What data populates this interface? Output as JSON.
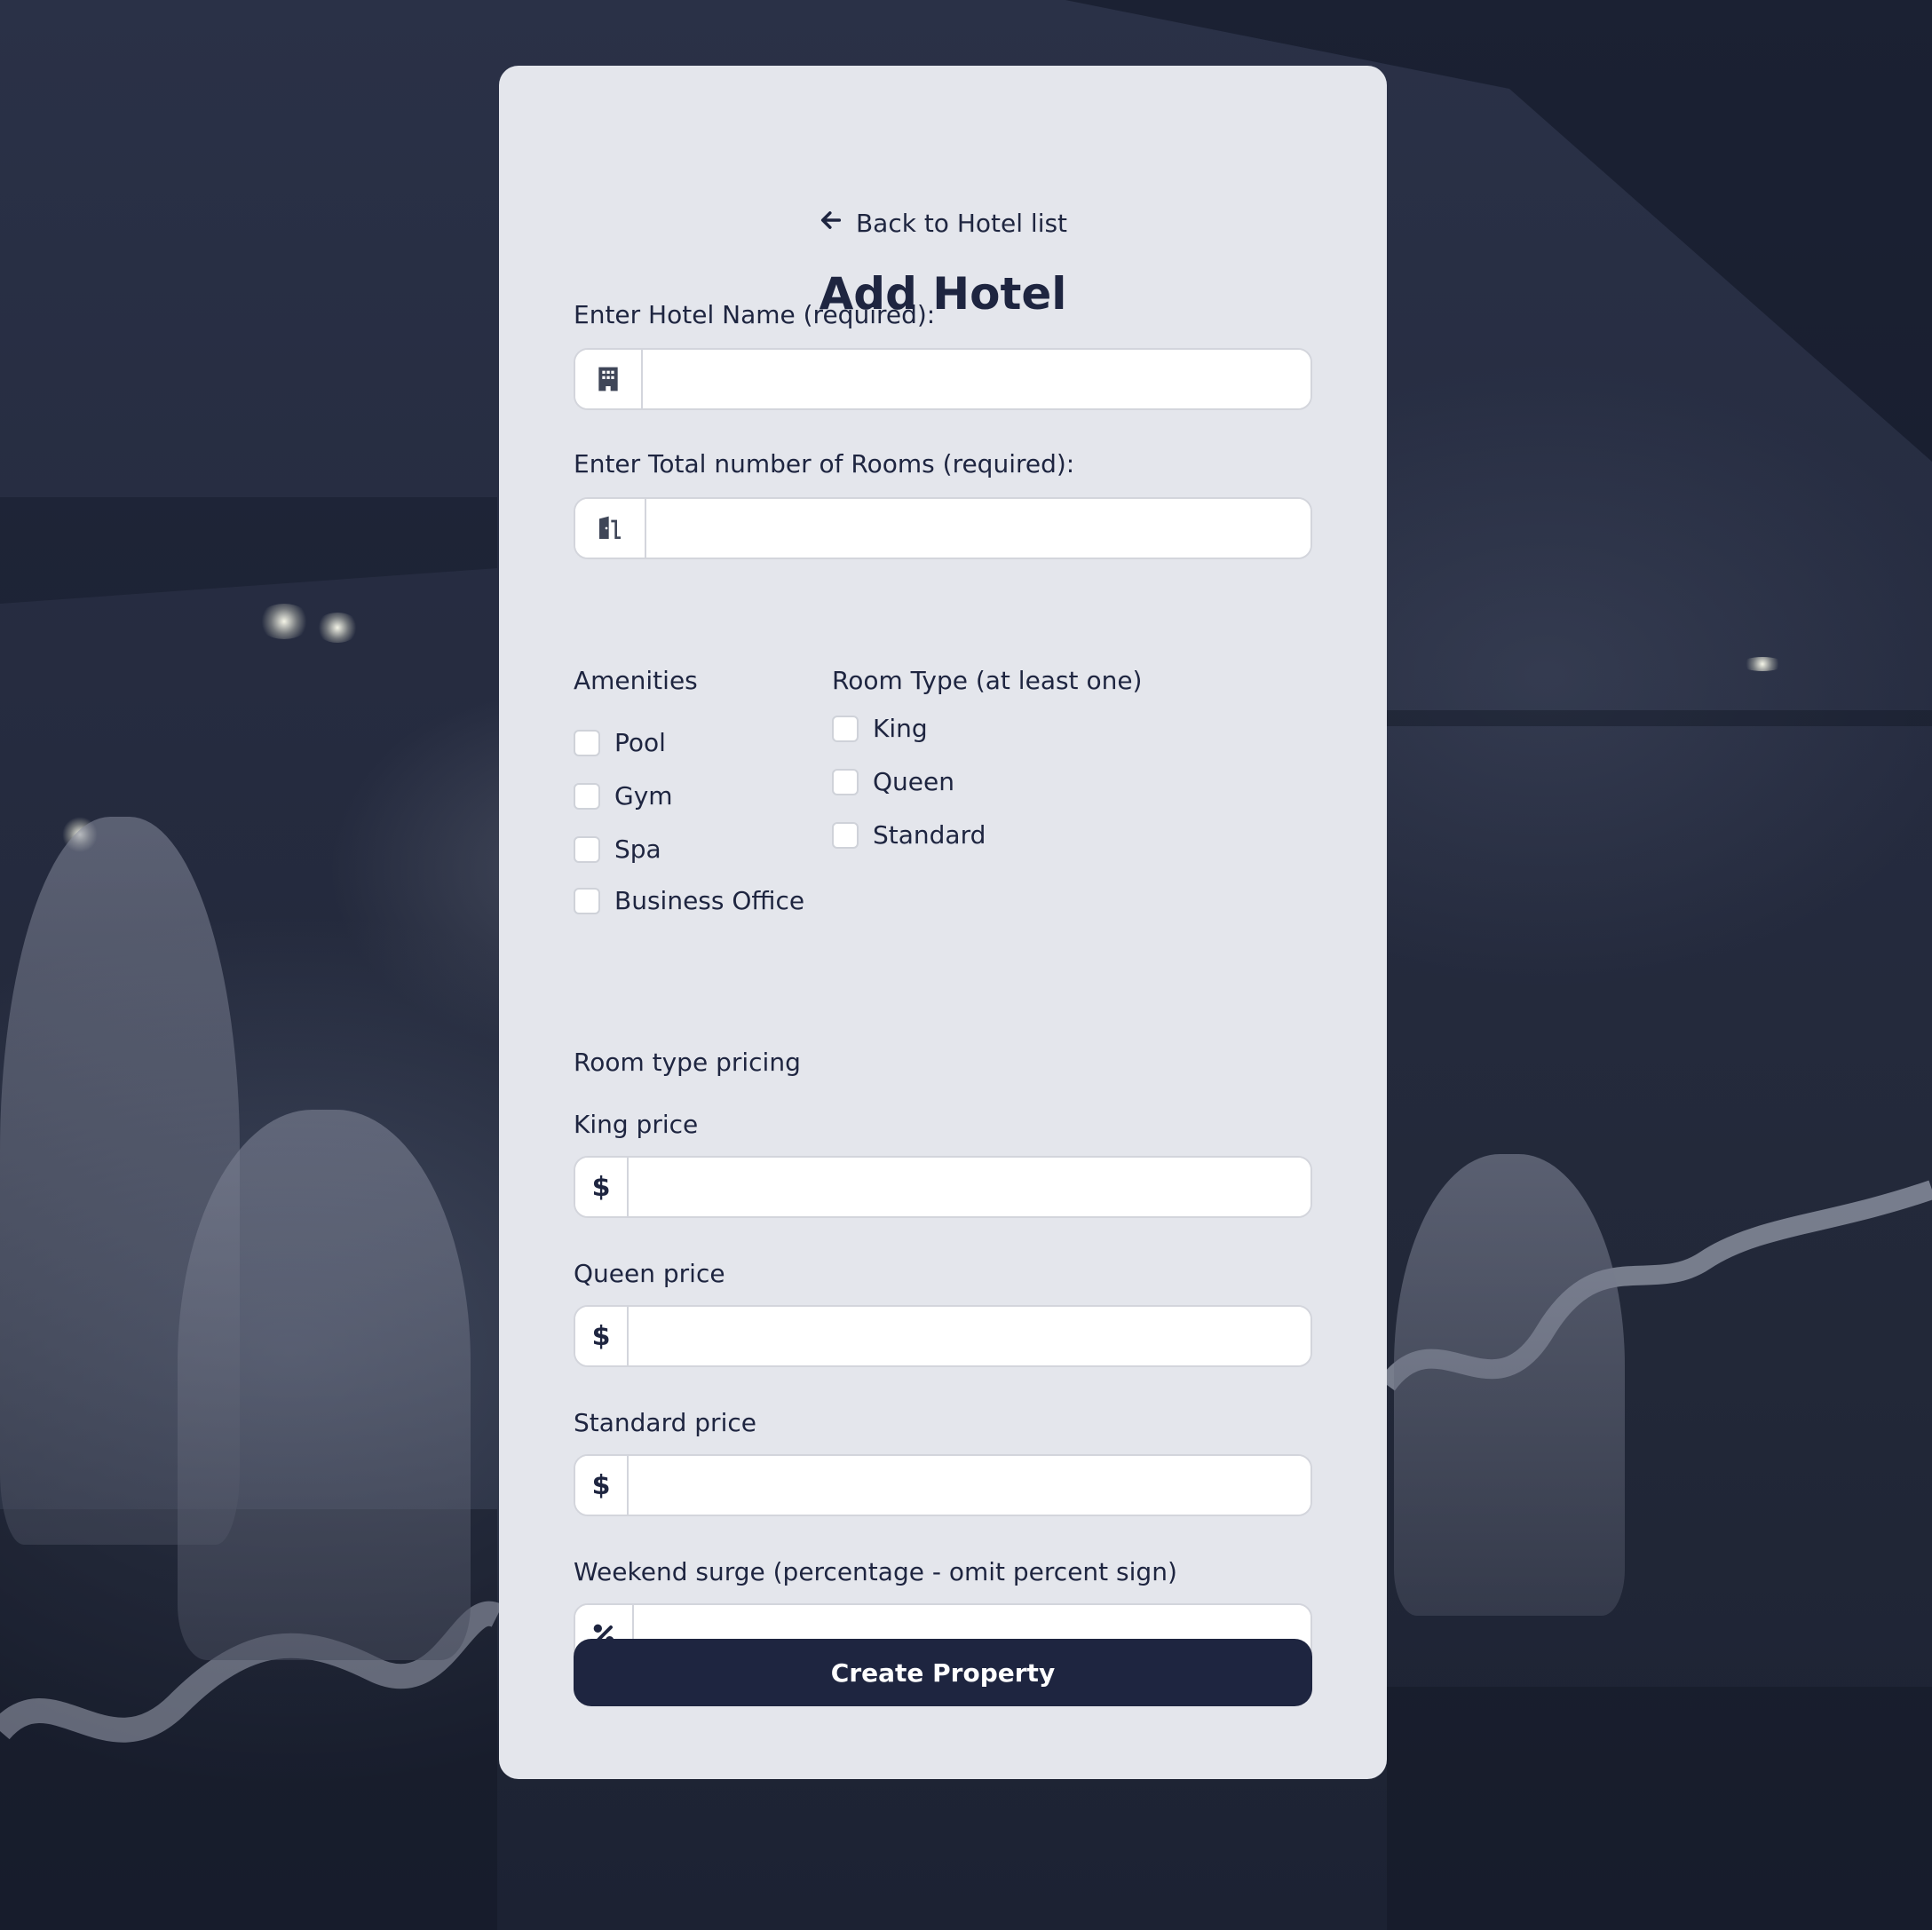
{
  "back_link": {
    "label": "Back to Hotel list",
    "icon": "arrow-left-icon"
  },
  "title": "Add Hotel",
  "hotel_name": {
    "label": "Enter Hotel Name (required):",
    "value": "",
    "icon": "building-icon"
  },
  "total_rooms": {
    "label": "Enter Total number of Rooms (required):",
    "value": "",
    "icon": "door-icon"
  },
  "amenities": {
    "heading": "Amenities",
    "options": [
      {
        "label": "Pool",
        "checked": false
      },
      {
        "label": "Gym",
        "checked": false
      },
      {
        "label": "Spa",
        "checked": false
      },
      {
        "label": "Business Office",
        "checked": false
      }
    ]
  },
  "room_types": {
    "heading": "Room Type (at least one)",
    "options": [
      {
        "label": "King",
        "checked": false
      },
      {
        "label": "Queen",
        "checked": false
      },
      {
        "label": "Standard",
        "checked": false
      }
    ]
  },
  "pricing": {
    "heading": "Room type pricing",
    "king": {
      "label": "King price",
      "prefix": "$",
      "value": ""
    },
    "queen": {
      "label": "Queen price",
      "prefix": "$",
      "value": ""
    },
    "standard": {
      "label": "Standard price",
      "prefix": "$",
      "value": ""
    },
    "weekend_surge": {
      "label": "Weekend surge (percentage - omit percent sign)",
      "value": "",
      "icon": "percent-icon"
    }
  },
  "submit_label": "Create Property",
  "colors": {
    "primary": "#1e2540",
    "card_bg": "#e4e6ec",
    "input_border": "#d3d5dc"
  }
}
